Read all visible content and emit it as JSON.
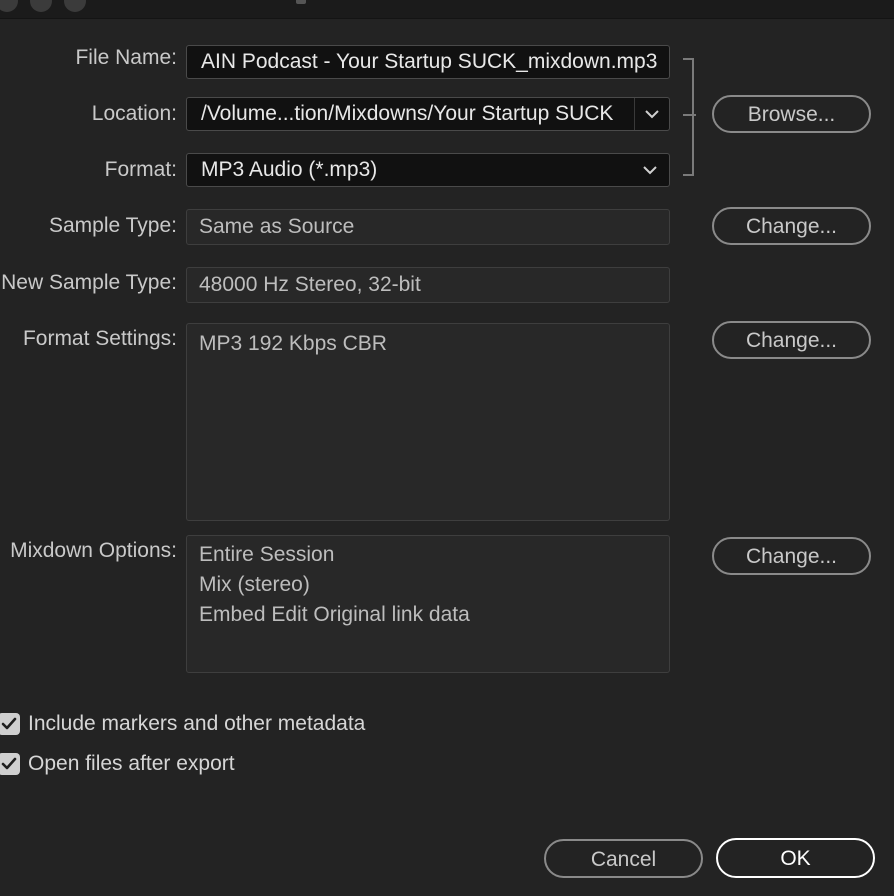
{
  "form": {
    "file_name": {
      "label": "File Name:",
      "value": "AIN Podcast - Your Startup SUCK_mixdown.mp3"
    },
    "location": {
      "label": "Location:",
      "value": "/Volume...tion/Mixdowns/Your Startup SUCK"
    },
    "format": {
      "label": "Format:",
      "value": "MP3 Audio (*.mp3)"
    },
    "sample_type": {
      "label": "Sample Type:",
      "value": "Same as Source"
    },
    "new_sample_type": {
      "label": "New Sample Type:",
      "value": "48000 Hz Stereo, 32-bit"
    },
    "format_settings": {
      "label": "Format Settings:",
      "value": "MP3 192 Kbps CBR"
    },
    "mixdown_options": {
      "label": "Mixdown Options:",
      "lines": [
        "Entire Session",
        "Mix (stereo)",
        "Embed Edit Original link data"
      ]
    }
  },
  "buttons": {
    "browse": "Browse...",
    "change_sample_type": "Change...",
    "change_format_settings": "Change...",
    "change_mixdown_options": "Change...",
    "cancel": "Cancel",
    "ok": "OK"
  },
  "checkboxes": {
    "include_markers": {
      "label": "Include markers and other metadata",
      "checked": true
    },
    "open_files": {
      "label": "Open files after export",
      "checked": true
    }
  },
  "icons": {
    "location_dropdown": "chevron-down-icon",
    "format_dropdown": "chevron-down-icon",
    "checkmark": "checkmark-icon"
  },
  "colors": {
    "background": "#232323",
    "field_background": "#111111",
    "ok_border": "#ffffff"
  }
}
